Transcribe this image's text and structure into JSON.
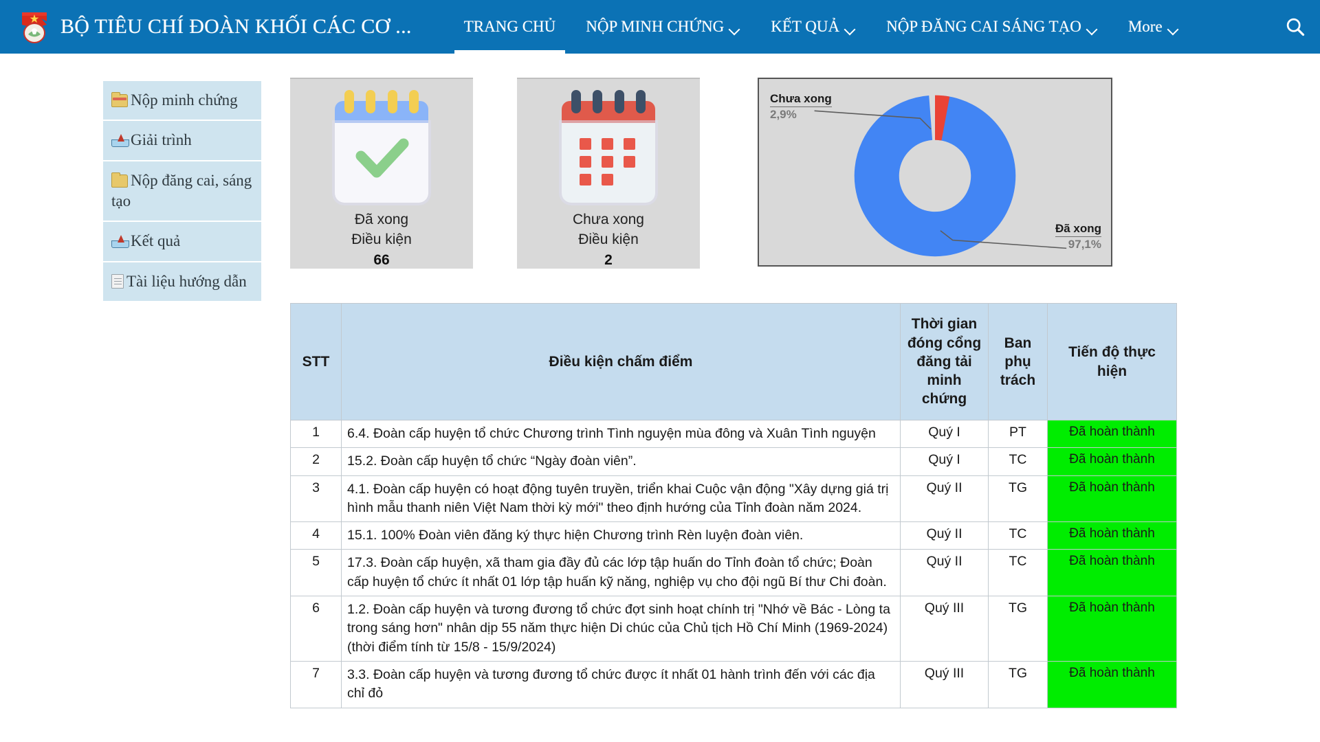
{
  "header": {
    "brand_title": "BỘ TIÊU CHÍ ĐOÀN KHỐI CÁC CƠ ...",
    "logo_icon": "doan-tncs-emblem",
    "search_icon": "search-icon",
    "accent_color": "#0b72b5",
    "nav": [
      {
        "label": "TRANG CHỦ",
        "has_caret": false,
        "active": true
      },
      {
        "label": "NỘP MINH CHỨNG",
        "has_caret": true,
        "active": false
      },
      {
        "label": "KẾT QUẢ",
        "has_caret": true,
        "active": false
      },
      {
        "label": "NỘP ĐĂNG CAI SÁNG TẠO",
        "has_caret": true,
        "active": false
      },
      {
        "label": "More",
        "has_caret": true,
        "active": false
      }
    ]
  },
  "sidebar": {
    "items": [
      {
        "label": "Nộp minh chứng",
        "icon": "folder-open-icon"
      },
      {
        "label": "Giải trình",
        "icon": "upload-tray-icon"
      },
      {
        "label": "Nộp đăng cai, sáng tạo",
        "icon": "folder-icon"
      },
      {
        "label": "Kết quả",
        "icon": "upload-tray-icon"
      },
      {
        "label": "Tài liệu hướng dẫn",
        "icon": "document-icon"
      }
    ]
  },
  "cards": [
    {
      "icon": "calendar-check-icon",
      "status": "Đã xong",
      "unit": "Điều kiện",
      "count": "66",
      "accent": "#6c9ff0"
    },
    {
      "icon": "calendar-pending-icon",
      "status": "Chưa xong",
      "unit": "Điều kiện",
      "count": "2",
      "accent": "#e05a4b"
    }
  ],
  "chart_data": {
    "type": "pie",
    "variant": "donut",
    "title": "",
    "labels": [
      "Đã xong",
      "Chưa xong"
    ],
    "values": [
      97.1,
      2.9
    ],
    "value_labels": [
      "97,1%",
      "2,9%"
    ],
    "colors": [
      "#4285f4",
      "#ea4335"
    ],
    "counts": [
      66,
      2
    ],
    "legend": "labels-with-leader-lines",
    "background": "#d9d9d9",
    "hole_ratio": 0.52
  },
  "table": {
    "columns": [
      "STT",
      "Điều kiện chấm điểm",
      "Thời gian đóng cổng đăng tải minh chứng",
      "Ban phụ trách",
      "Tiến độ thực hiện"
    ],
    "rows": [
      {
        "stt": "1",
        "desc": "6.4. Đoàn cấp huyện tổ chức Chương trình Tình nguyện mùa đông và Xuân Tình nguyện",
        "thoi_gian": "Quý I",
        "ban": "PT",
        "tien_do": "Đã hoàn thành"
      },
      {
        "stt": "2",
        "desc": "15.2. Đoàn cấp huyện tổ chức “Ngày đoàn viên”.",
        "thoi_gian": "Quý I",
        "ban": "TC",
        "tien_do": "Đã hoàn thành"
      },
      {
        "stt": "3",
        "desc": "4.1. Đoàn cấp huyện có hoạt động tuyên truyền, triển khai Cuộc vận động \"Xây dựng giá trị hình mẫu thanh niên Việt Nam thời kỳ mới\" theo định hướng của Tỉnh đoàn năm 2024.",
        "thoi_gian": "Quý II",
        "ban": "TG",
        "tien_do": "Đã hoàn thành"
      },
      {
        "stt": "4",
        "desc": "15.1. 100% Đoàn viên đăng ký thực hiện Chương trình Rèn luyện đoàn viên.",
        "thoi_gian": "Quý II",
        "ban": "TC",
        "tien_do": "Đã hoàn thành"
      },
      {
        "stt": "5",
        "desc": "17.3. Đoàn cấp huyện, xã tham gia đầy đủ các lớp tập huấn do Tỉnh đoàn tổ chức; Đoàn cấp huyện tổ chức ít nhất 01 lớp tập huấn kỹ năng, nghiệp vụ cho đội ngũ Bí thư Chi đoàn.",
        "thoi_gian": "Quý II",
        "ban": "TC",
        "tien_do": "Đã hoàn thành"
      },
      {
        "stt": "6",
        "desc": "1.2. Đoàn cấp huyện và tương đương tổ chức đợt sinh hoạt chính trị \"Nhớ về Bác - Lòng ta trong sáng hơn\" nhân dịp 55 năm thực hiện Di chúc của Chủ tịch Hồ Chí Minh (1969-2024) (thời điểm tính từ 15/8 - 15/9/2024)",
        "thoi_gian": "Quý III",
        "ban": "TG",
        "tien_do": "Đã hoàn thành"
      },
      {
        "stt": "7",
        "desc": "3.3. Đoàn cấp huyện và tương đương tổ chức được ít nhất 01 hành trình đến với các địa chỉ đỏ",
        "thoi_gian": "Quý III",
        "ban": "TG",
        "tien_do": "Đã hoàn thành"
      }
    ]
  }
}
